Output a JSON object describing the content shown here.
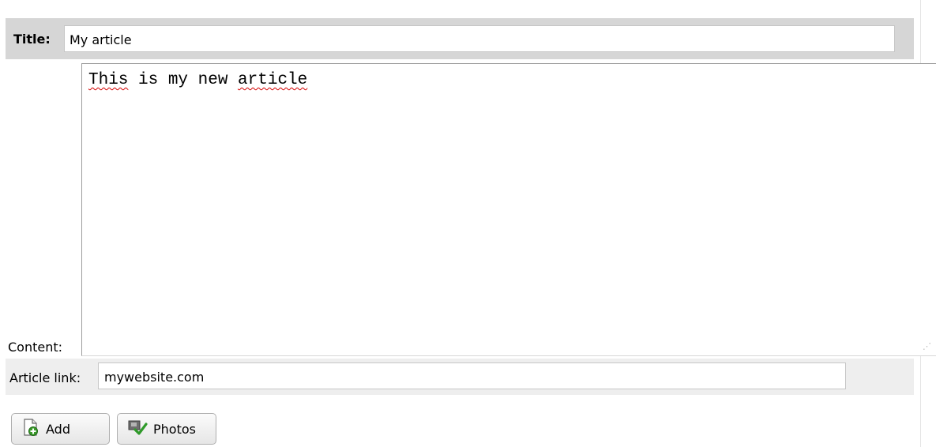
{
  "title_field": {
    "label": "Title:",
    "value": "My article"
  },
  "content_field": {
    "label": "Content:",
    "words": [
      "This",
      " is my new ",
      "article"
    ]
  },
  "link_field": {
    "label": "Article link:",
    "value": "mywebsite.com"
  },
  "buttons": {
    "add": {
      "label": "Add",
      "icon": "add-document-icon"
    },
    "photos": {
      "label": "Photos",
      "icon": "photos-check-icon"
    }
  },
  "colors": {
    "spellcheck_underline": "#d40000",
    "title_row_bg": "#d6d6d6",
    "link_row_bg": "#eeeeee"
  }
}
